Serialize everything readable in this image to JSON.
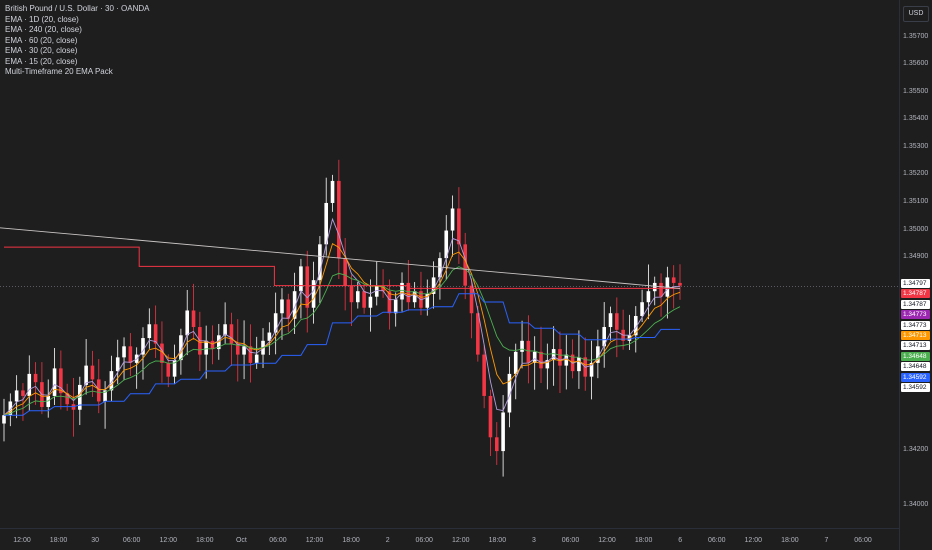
{
  "legend": {
    "title": "British Pound / U.S. Dollar · 30 · OANDA",
    "lines": [
      "EMA · 1D (20, close)",
      "EMA · 240 (20, close)",
      "EMA · 60 (20, close)",
      "EMA · 30 (20, close)",
      "EMA · 15 (20, close)",
      "Multi-Timeframe 20 EMA Pack"
    ]
  },
  "currency": "USD",
  "colors": {
    "background": "#1e1e1e",
    "up": "#ffffff",
    "down": "#f23645",
    "ema_1d": "#f23645",
    "ema_240": "#c9c4c4",
    "ema_60": "#2962ff",
    "ema_30": "#4caf50",
    "ema_15": "#ff9800",
    "ema_fast": "#b39ddb"
  },
  "chart_data": {
    "type": "candlestick",
    "symbol": "GBPUSD",
    "ylim": [
      1.3395,
      1.358
    ],
    "y_ticks": [
      "1.35700",
      "1.35600",
      "1.35500",
      "1.35400",
      "1.35300",
      "1.35200",
      "1.35100",
      "1.35000",
      "1.34900",
      "1.34200",
      "1.34000"
    ],
    "x_ticks": [
      "12:00",
      "18:00",
      "30",
      "06:00",
      "12:00",
      "18:00",
      "Oct",
      "06:00",
      "12:00",
      "18:00",
      "2",
      "06:00",
      "12:00",
      "18:00",
      "3",
      "06:00",
      "12:00",
      "18:00",
      "6",
      "06:00",
      "12:00",
      "18:00",
      "7",
      "06:00"
    ],
    "last_price": "1.34797",
    "badges": [
      {
        "text": "1.34797",
        "bg": "#ffffff",
        "fg": "#131722"
      },
      {
        "text": "1.34787",
        "bg": "#f23645",
        "fg": "#ffffff"
      },
      {
        "text": "1.34787",
        "bg": "#ffffff",
        "fg": "#131722"
      },
      {
        "text": "1.34773",
        "bg": "#9c27b0",
        "fg": "#ffffff"
      },
      {
        "text": "1.34773",
        "bg": "#ffffff",
        "fg": "#131722"
      },
      {
        "text": "1.34713",
        "bg": "#ff9800",
        "fg": "#ffffff"
      },
      {
        "text": "1.34713",
        "bg": "#ffffff",
        "fg": "#131722"
      },
      {
        "text": "1.34648",
        "bg": "#4caf50",
        "fg": "#ffffff"
      },
      {
        "text": "1.34648",
        "bg": "#ffffff",
        "fg": "#131722"
      },
      {
        "text": "1.34592",
        "bg": "#2962ff",
        "fg": "#ffffff"
      },
      {
        "text": "1.34592",
        "bg": "#ffffff",
        "fg": "#131722"
      }
    ],
    "close_path": [
      1.3433,
      1.3438,
      1.3442,
      1.344,
      1.3448,
      1.3445,
      1.3436,
      1.344,
      1.345,
      1.3441,
      1.3437,
      1.3435,
      1.3444,
      1.3451,
      1.3446,
      1.3438,
      1.3442,
      1.3449,
      1.3454,
      1.3458,
      1.3452,
      1.3455,
      1.3461,
      1.3466,
      1.3459,
      1.3452,
      1.3447,
      1.3453,
      1.3462,
      1.3471,
      1.3465,
      1.3455,
      1.346,
      1.3457,
      1.3462,
      1.3466,
      1.3459,
      1.3455,
      1.3458,
      1.3452,
      1.3455,
      1.346,
      1.3463,
      1.347,
      1.3475,
      1.3468,
      1.3478,
      1.3487,
      1.3472,
      1.3482,
      1.3495,
      1.351,
      1.3518,
      1.349,
      1.348,
      1.3474,
      1.3478,
      1.3472,
      1.3476,
      1.348,
      1.3478,
      1.347,
      1.3475,
      1.3481,
      1.3474,
      1.3478,
      1.3472,
      1.3477,
      1.3483,
      1.349,
      1.35,
      1.3508,
      1.3495,
      1.348,
      1.347,
      1.3455,
      1.344,
      1.3425,
      1.342,
      1.3434,
      1.3448,
      1.3456,
      1.346,
      1.3452,
      1.3456,
      1.345,
      1.3453,
      1.3457,
      1.3451,
      1.3455,
      1.3449,
      1.3454,
      1.3447,
      1.3452,
      1.3458,
      1.3465,
      1.347,
      1.3464,
      1.346,
      1.3462,
      1.3469,
      1.3474,
      1.3478,
      1.3481,
      1.3476,
      1.3483,
      1.3481,
      1.348
    ]
  }
}
